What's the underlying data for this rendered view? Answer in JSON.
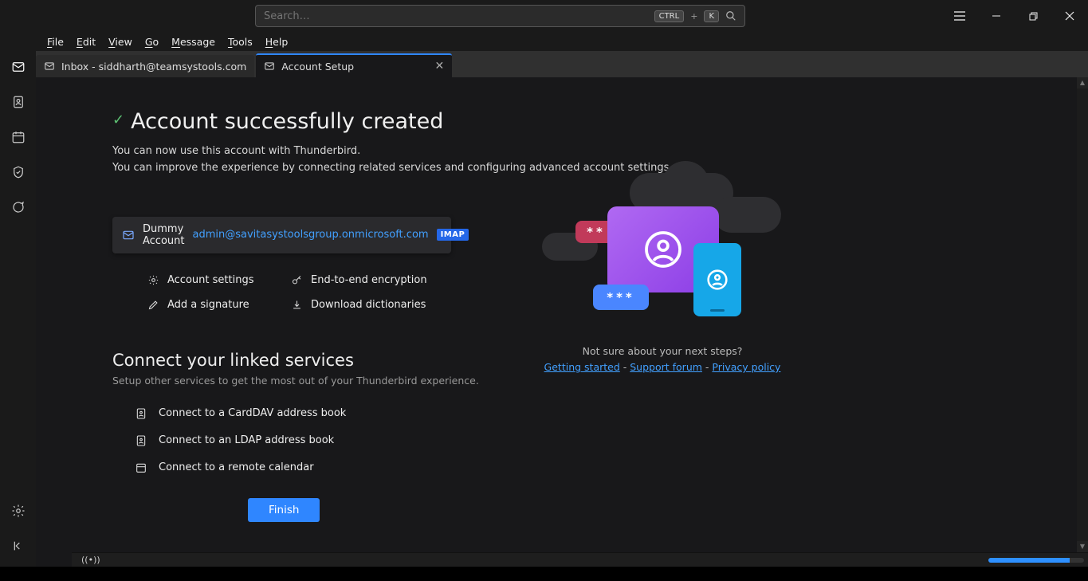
{
  "search": {
    "placeholder": "Search…",
    "kbd1": "CTRL",
    "plus": "+",
    "kbd2": "K"
  },
  "menu": [
    "File",
    "Edit",
    "View",
    "Go",
    "Message",
    "Tools",
    "Help"
  ],
  "tabs": [
    {
      "label": "Inbox - siddharth@teamsystools.com"
    },
    {
      "label": "Account Setup"
    }
  ],
  "page": {
    "title": "Account successfully created",
    "sub1": "You can now use this account with Thunderbird.",
    "sub2": "You can improve the experience by connecting related services and configuring advanced account settings."
  },
  "account": {
    "name": "Dummy Account",
    "email": "admin@savitasystoolsgroup.onmicrosoft.com",
    "proto": "IMAP"
  },
  "actions": {
    "settings": "Account settings",
    "e2e": "End-to-end encryption",
    "signature": "Add a signature",
    "dict": "Download dictionaries"
  },
  "linked": {
    "hdr": "Connect your linked services",
    "sub": "Setup other services to get the most out of your Thunderbird experience.",
    "carddav": "Connect to a CardDAV address book",
    "ldap": "Connect to an LDAP address book",
    "cal": "Connect to a remote calendar"
  },
  "finish": "Finish",
  "help": {
    "q": "Not sure about your next steps?",
    "l1": "Getting started",
    "l2": "Support forum",
    "l3": "Privacy policy",
    "sep": " - "
  }
}
